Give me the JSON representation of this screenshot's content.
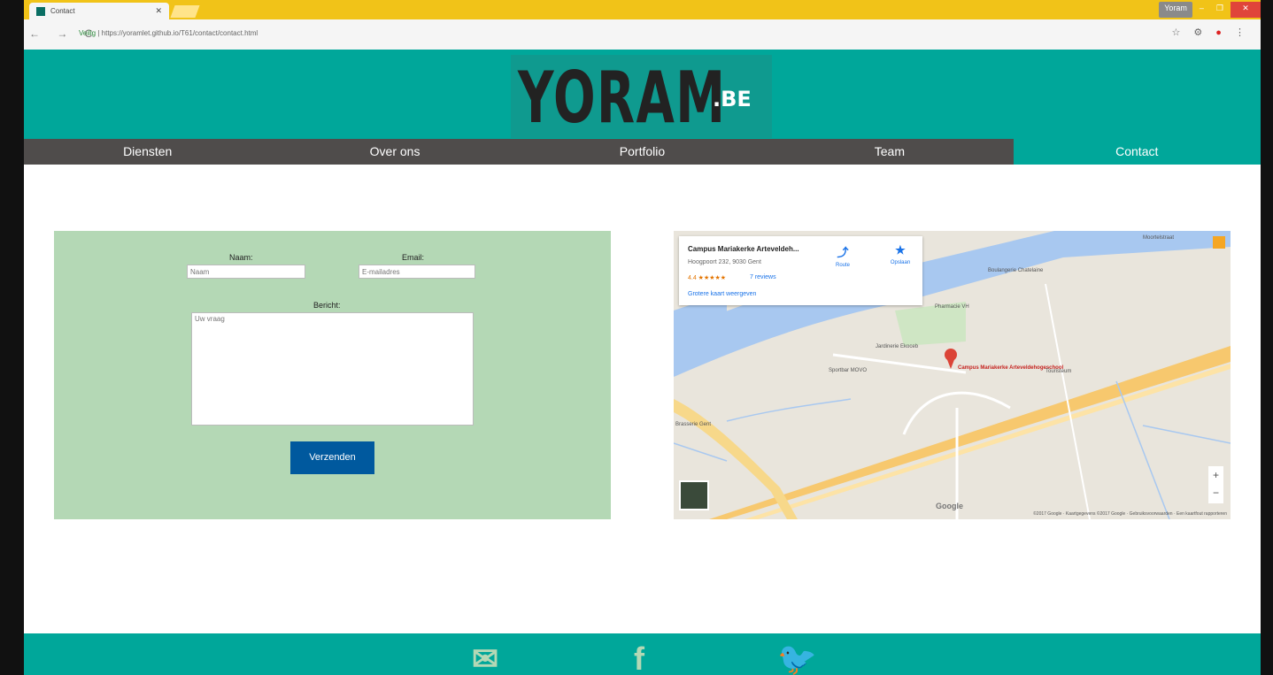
{
  "browser": {
    "tab_title": "Contact",
    "tab_close": "✕",
    "url_secure": "Veilig",
    "url_text": "https://yoramlet.github.io/T61/contact/contact.html",
    "nav_icons": "← → C",
    "window_user": "Yoram",
    "minimize": "–",
    "maximize": "❐",
    "close": "✕"
  },
  "site": {
    "logo_main": "YORAM",
    "logo_tld": ".BE",
    "nav": [
      "Diensten",
      "Over ons",
      "Portfolio",
      "Team",
      "Contact"
    ],
    "active_nav": "Contact"
  },
  "form": {
    "name_label": "Naam:",
    "name_placeholder": "Naam",
    "email_label": "Email:",
    "email_placeholder": "E-mailadres",
    "message_label": "Bericht:",
    "message_placeholder": "Uw vraag",
    "submit_label": "Verzenden"
  },
  "map": {
    "place_title": "Campus Mariakerke Arteveldeh...",
    "place_address": "Hoogpoort 232, 9030 Gent",
    "rating": "4.4 ★★★★★",
    "reviews": "7 reviews",
    "larger_map": "Grotere kaart weergeven",
    "directions_label": "Route",
    "save_label": "Opslaan",
    "labels": {
      "campus": "Campus Mariakerke Arteveldehogeschool",
      "pharmacy": "Pharmacie VH",
      "jardinerie": "Jardinerie Ekoceb",
      "sportbar": "Sportbar MOVO",
      "tourist": "Touristeum",
      "bakery": "Boulangerie Chatelaine",
      "brasserie": "Brasserie Gent",
      "top_right": "Moortelstraat"
    },
    "zoom_in": "+",
    "zoom_out": "−",
    "google": "Google",
    "copyright": "©2017 Google · Kaartgegevens ©2017 Google · Gebruiksvoorwaarden · Een kaartfout rapporteren"
  },
  "footer": {
    "icons": [
      "mail-icon",
      "facebook-icon",
      "twitter-icon"
    ]
  },
  "colors": {
    "brand_teal": "#00a79a",
    "nav_dark": "#4f4c4b",
    "form_green": "#b4d8b5",
    "button_blue": "#00599e"
  }
}
